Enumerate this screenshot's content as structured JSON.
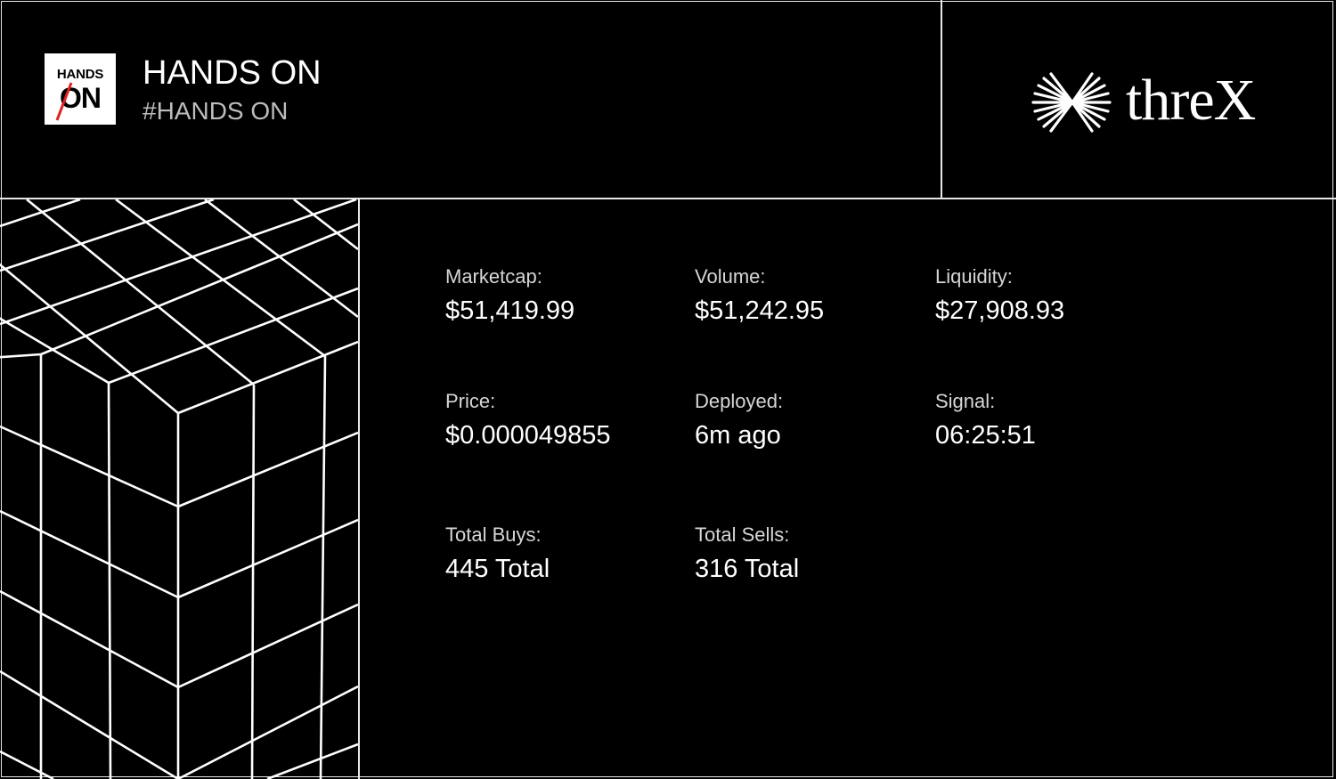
{
  "token": {
    "logo_text_top": "HANDS",
    "logo_text_bottom": "ON",
    "name": "HANDS ON",
    "ticker": "#HANDS ON"
  },
  "brand": {
    "name": "threX",
    "icon": "burst-icon"
  },
  "stats": {
    "marketcap": {
      "label": "Marketcap:",
      "value": "$51,419.99"
    },
    "volume": {
      "label": "Volume:",
      "value": "$51,242.95"
    },
    "liquidity": {
      "label": "Liquidity:",
      "value": "$27,908.93"
    },
    "price": {
      "label": "Price:",
      "value": "$0.000049855"
    },
    "deployed": {
      "label": "Deployed:",
      "value": "6m ago"
    },
    "signal": {
      "label": "Signal:",
      "value": "06:25:51"
    },
    "total_buys": {
      "label": "Total Buys:",
      "value": "445 Total"
    },
    "total_sells": {
      "label": "Total Sells:",
      "value": "316 Total"
    }
  },
  "colors": {
    "background": "#000000",
    "foreground": "#ffffff",
    "muted": "#bdbdbd",
    "accent_slash": "#e02020"
  }
}
